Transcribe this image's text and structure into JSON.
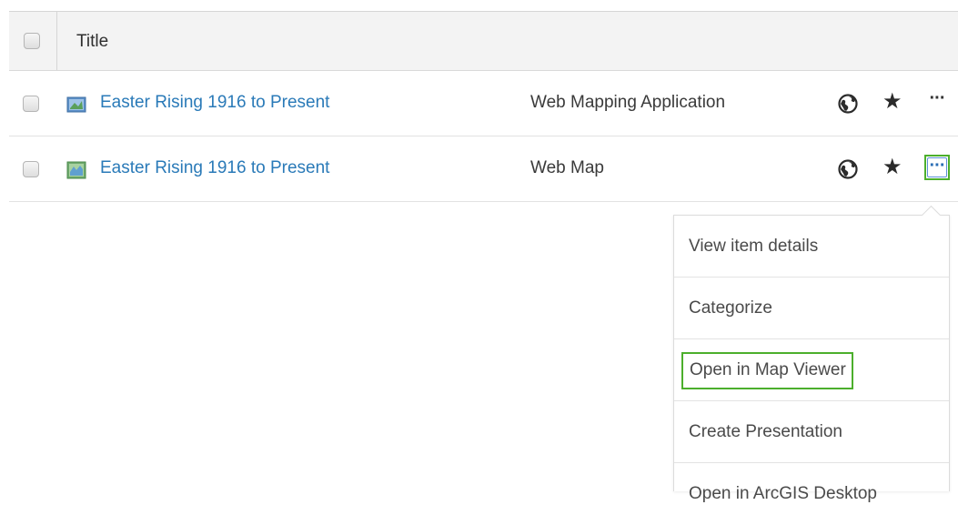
{
  "header": {
    "title_label": "Title"
  },
  "rows": [
    {
      "title": "Easter Rising 1916 to Present",
      "type": "Web Mapping Application",
      "item_icon": "web-mapping-application-icon",
      "more_label": "···"
    },
    {
      "title": "Easter Rising 1916 to Present",
      "type": "Web Map",
      "item_icon": "web-map-icon",
      "more_label": "···"
    }
  ],
  "icons": {
    "globe": "globe-icon",
    "star": "★"
  },
  "menu": {
    "items": [
      {
        "label": "View item details"
      },
      {
        "label": "Categorize"
      },
      {
        "label": "Open in Map Viewer"
      },
      {
        "label": "Create Presentation"
      },
      {
        "label": "Open in ArcGIS Desktop"
      }
    ]
  },
  "colors": {
    "link": "#2a7ab8",
    "highlight": "#4caf2c"
  }
}
